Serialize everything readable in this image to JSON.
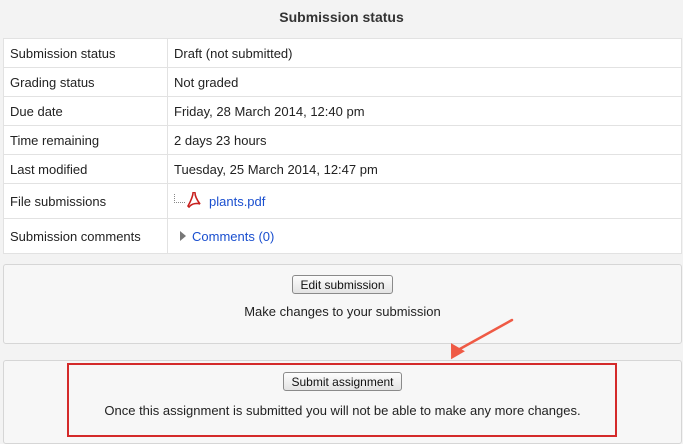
{
  "header": {
    "title": "Submission status"
  },
  "status_table": {
    "rows": [
      {
        "label": "Submission status",
        "value": "Draft (not submitted)"
      },
      {
        "label": "Grading status",
        "value": "Not graded"
      },
      {
        "label": "Due date",
        "value": "Friday, 28 March 2014, 12:40 pm"
      },
      {
        "label": "Time remaining",
        "value": "2 days 23 hours"
      },
      {
        "label": "Last modified",
        "value": "Tuesday, 25 March 2014, 12:47 pm"
      },
      {
        "label": "File submissions",
        "file_name": "plants.pdf",
        "icon": "pdf-icon"
      },
      {
        "label": "Submission comments",
        "link": "Comments (0)",
        "icon": "expand-triangle-icon"
      }
    ]
  },
  "edit_box": {
    "button_label": "Edit submission",
    "description": "Make changes to your submission"
  },
  "submit_box": {
    "button_label": "Submit assignment",
    "description": "Once this assignment is submitted you will not be able to make any more changes."
  },
  "annotation": {
    "highlight_color": "#d42a2a",
    "arrow_color": "#ef5a45"
  }
}
